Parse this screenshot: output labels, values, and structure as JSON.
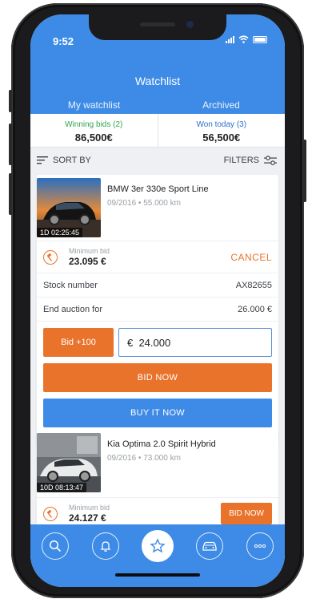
{
  "status": {
    "time": "9:52"
  },
  "header": {
    "title": "Watchlist"
  },
  "tabs": [
    {
      "label": "My watchlist",
      "active": true
    },
    {
      "label": "Archived",
      "active": false
    }
  ],
  "summary": {
    "winning_label": "Winning bids (2)",
    "winning_value": "86,500€",
    "won_label": "Won today (3)",
    "won_value": "56,500€"
  },
  "toolbar": {
    "sort_label": "SORT BY",
    "filters_label": "FILTERS"
  },
  "listing1": {
    "name": "BMW 3er 330e Sport Line",
    "meta": "09/2016 • 55.000 km",
    "timer": "1D 02:25:45",
    "min_bid_label": "Minimum bid",
    "min_bid_value": "23.095 €",
    "cancel_label": "CANCEL",
    "stock_label": "Stock number",
    "stock_value": "AX82655",
    "end_label": "End auction for",
    "end_value": "26.000 €",
    "plus_label": "Bid +100",
    "bid_value": "€  24.000",
    "bid_now_label": "BID NOW",
    "buy_now_label": "BUY IT NOW"
  },
  "listing2": {
    "name": "Kia Optima 2.0 Spirit Hybrid",
    "meta": "09/2016 • 73.000 km",
    "timer": "10D 08:13:47",
    "min_bid_label": "Minimum bid",
    "min_bid_value": "24.127 €",
    "bid_now_label": "BID NOW"
  },
  "bottom_nav": [
    {
      "icon": "search-icon"
    },
    {
      "icon": "bell-icon"
    },
    {
      "icon": "star-icon",
      "active": true
    },
    {
      "icon": "car-icon"
    },
    {
      "icon": "more-icon"
    }
  ],
  "colors": {
    "primary": "#3d8be6",
    "accent": "#e9732b",
    "green": "#2fa44f"
  }
}
